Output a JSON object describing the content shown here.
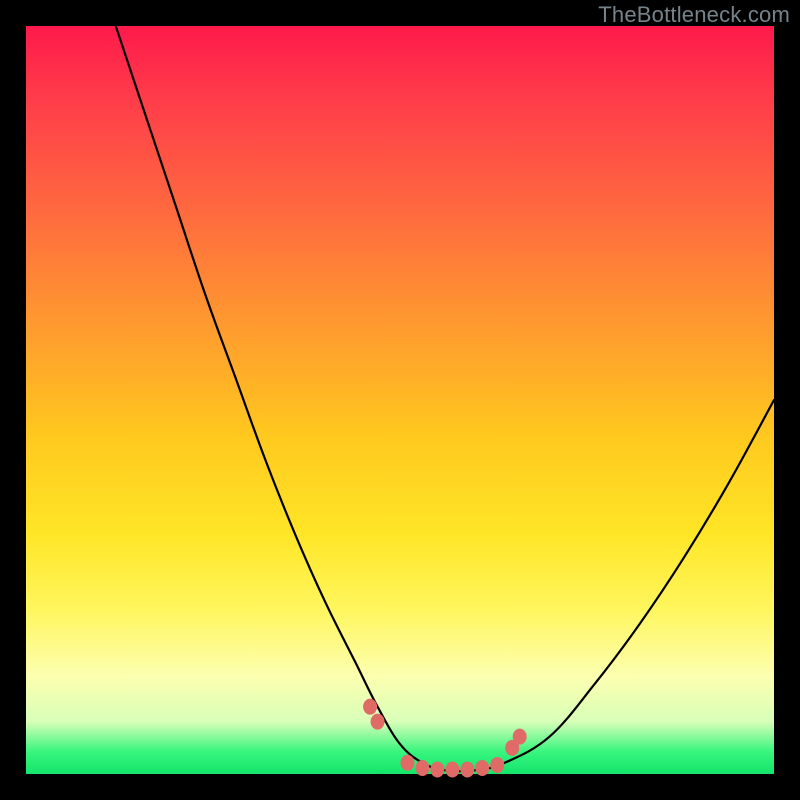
{
  "watermark": "TheBottleneck.com",
  "chart_data": {
    "type": "line",
    "title": "",
    "xlabel": "",
    "ylabel": "",
    "xlim": [
      0,
      100
    ],
    "ylim": [
      0,
      100
    ],
    "series": [
      {
        "name": "bottleneck-curve",
        "x": [
          12,
          16,
          20,
          24,
          28,
          32,
          36,
          40,
          44,
          47,
          50,
          53,
          56,
          60,
          64,
          70,
          76,
          82,
          88,
          94,
          100
        ],
        "y": [
          100,
          88,
          76,
          64,
          53,
          42,
          32,
          23,
          15,
          9,
          4,
          1.5,
          0.5,
          0.5,
          1.5,
          5,
          12,
          20,
          29,
          39,
          50
        ]
      }
    ],
    "markers": {
      "name": "highlight-dots",
      "x": [
        46,
        47,
        51,
        53,
        55,
        57,
        59,
        61,
        63,
        65,
        66
      ],
      "y": [
        9,
        7,
        1.5,
        0.8,
        0.6,
        0.6,
        0.6,
        0.8,
        1.2,
        3.5,
        5
      ]
    },
    "gradient_stops": [
      {
        "pos": 0,
        "color": "#ff1a4b"
      },
      {
        "pos": 25,
        "color": "#ff6a3f"
      },
      {
        "pos": 55,
        "color": "#ffc91e"
      },
      {
        "pos": 85,
        "color": "#fcffb0"
      },
      {
        "pos": 100,
        "color": "#13e56a"
      }
    ]
  }
}
